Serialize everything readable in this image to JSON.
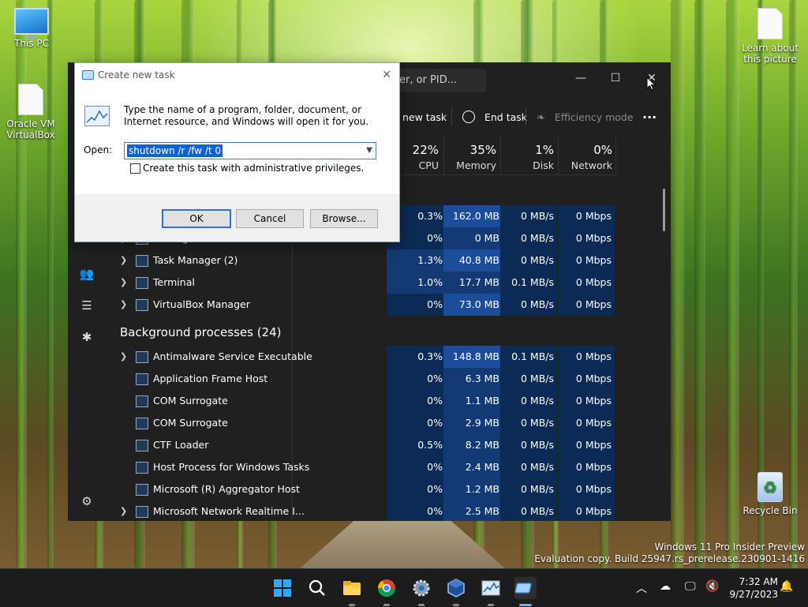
{
  "desktop": {
    "icons": [
      {
        "label": "This PC",
        "icon": "this-pc-icon"
      },
      {
        "label": "Oracle VM VirtualBox",
        "icon": "virtualbox-shortcut-icon"
      },
      {
        "label": "Learn about this picture",
        "icon": "document-icon"
      },
      {
        "label": "Recycle Bin",
        "icon": "recycle-bin-icon"
      }
    ],
    "watermark": {
      "line1": "Windows 11 Pro Insider Preview",
      "line2": "Evaluation copy. Build 25947.rs_prerelease.230901-1416"
    }
  },
  "task_manager": {
    "search_placeholder": "er, or PID...",
    "toolbar": {
      "run_new_task": "new task",
      "end_task": "End task",
      "efficiency_mode": "Efficiency mode",
      "more": "···"
    },
    "columns": [
      {
        "pct": "22%",
        "label": "CPU"
      },
      {
        "pct": "35%",
        "label": "Memory"
      },
      {
        "pct": "1%",
        "label": "Disk"
      },
      {
        "pct": "0%",
        "label": "Network"
      }
    ],
    "apps": [
      {
        "name": "",
        "cpu": "0.3%",
        "memory": "162.0 MB",
        "disk": "0 MB/s",
        "network": "0 Mbps",
        "expand": false
      },
      {
        "name": "Settings",
        "cpu": "0%",
        "memory": "0 MB",
        "disk": "0 MB/s",
        "network": "0 Mbps",
        "expand": true
      },
      {
        "name": "Task Manager (2)",
        "cpu": "1.3%",
        "memory": "40.8 MB",
        "disk": "0 MB/s",
        "network": "0 Mbps",
        "expand": true
      },
      {
        "name": "Terminal",
        "cpu": "1.0%",
        "memory": "17.7 MB",
        "disk": "0.1 MB/s",
        "network": "0 Mbps",
        "expand": true
      },
      {
        "name": "VirtualBox Manager",
        "cpu": "0%",
        "memory": "73.0 MB",
        "disk": "0 MB/s",
        "network": "0 Mbps",
        "expand": true
      }
    ],
    "background_title": "Background processes (24)",
    "background": [
      {
        "name": "Antimalware Service Executable",
        "cpu": "0.3%",
        "memory": "148.8 MB",
        "disk": "0.1 MB/s",
        "network": "0 Mbps",
        "expand": true
      },
      {
        "name": "Application Frame Host",
        "cpu": "0%",
        "memory": "6.3 MB",
        "disk": "0 MB/s",
        "network": "0 Mbps",
        "expand": false
      },
      {
        "name": "COM Surrogate",
        "cpu": "0%",
        "memory": "1.1 MB",
        "disk": "0 MB/s",
        "network": "0 Mbps",
        "expand": false
      },
      {
        "name": "COM Surrogate",
        "cpu": "0%",
        "memory": "2.9 MB",
        "disk": "0 MB/s",
        "network": "0 Mbps",
        "expand": false
      },
      {
        "name": "CTF Loader",
        "cpu": "0.5%",
        "memory": "8.2 MB",
        "disk": "0 MB/s",
        "network": "0 Mbps",
        "expand": false
      },
      {
        "name": "Host Process for Windows Tasks",
        "cpu": "0%",
        "memory": "2.4 MB",
        "disk": "0 MB/s",
        "network": "0 Mbps",
        "expand": false
      },
      {
        "name": "Microsoft (R) Aggregator Host",
        "cpu": "0%",
        "memory": "1.2 MB",
        "disk": "0 MB/s",
        "network": "0 Mbps",
        "expand": false
      },
      {
        "name": "Microsoft Network Realtime I...",
        "cpu": "0%",
        "memory": "2.5 MB",
        "disk": "0 MB/s",
        "network": "0 Mbps",
        "expand": true
      }
    ]
  },
  "run_dialog": {
    "title": "Create new task",
    "description": "Type the name of a program, folder, document, or Internet resource, and Windows will open it for you.",
    "open_label": "Open:",
    "command": "shutdown /r /fw /t 0",
    "admin_checkbox": "Create this task with administrative privileges.",
    "ok": "OK",
    "cancel": "Cancel",
    "browse": "Browse..."
  },
  "taskbar": {
    "time": "7:32 AM",
    "date": "9/27/2023"
  },
  "colors": {
    "accent": "#0a64d6",
    "heat_dark": "#0c2a56",
    "heat_mid": "#133a75",
    "heat_light": "#1b4d9a"
  }
}
